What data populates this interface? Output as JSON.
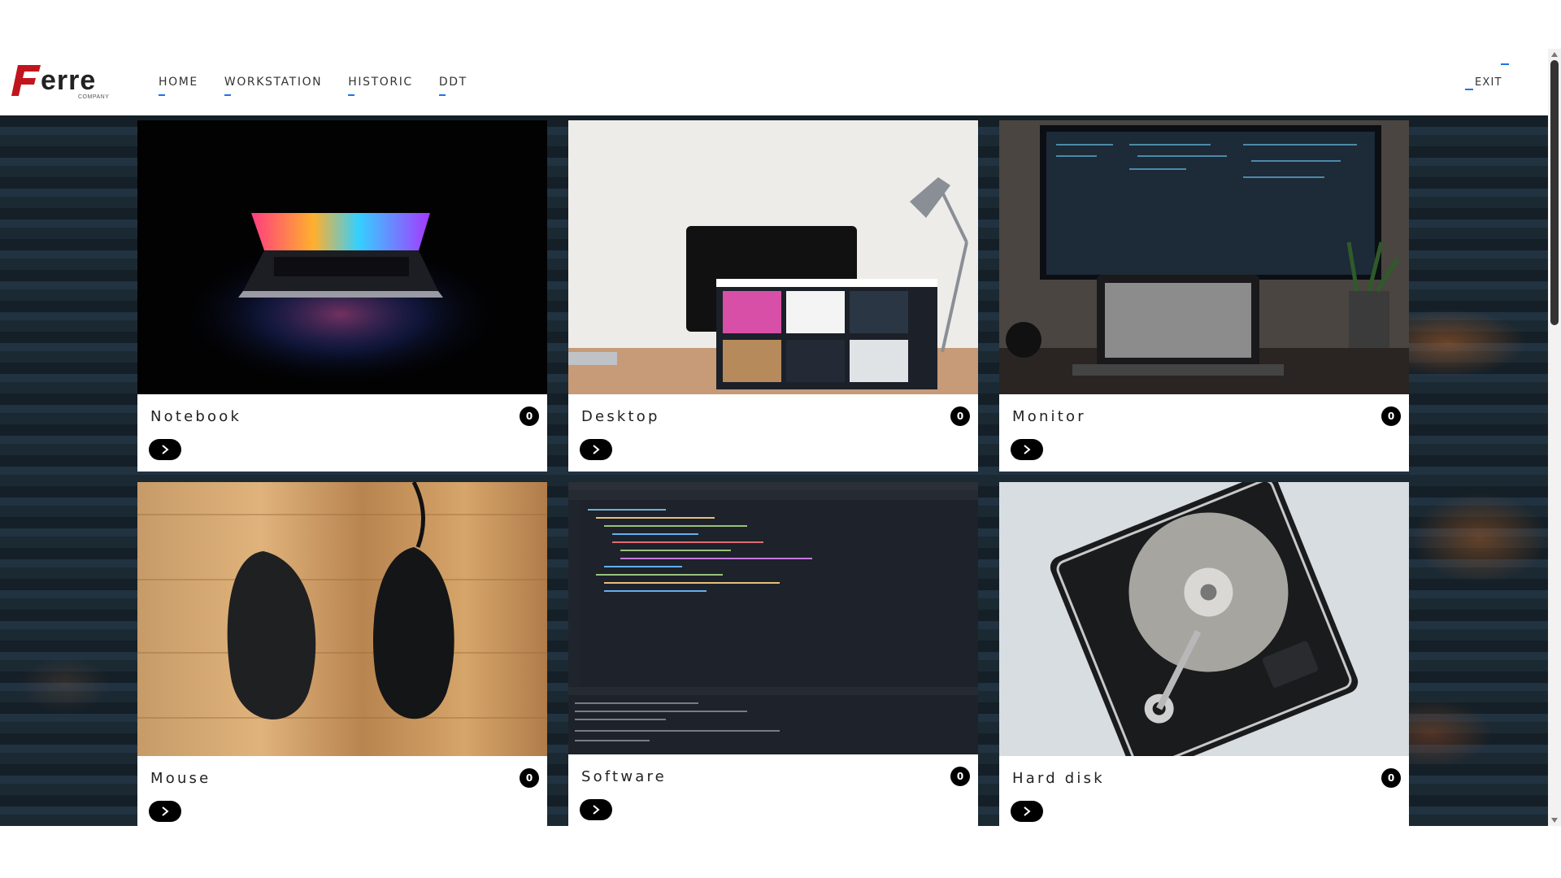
{
  "brand": {
    "name": "erre",
    "sub": "COMPANY",
    "accent": "#c0151d"
  },
  "nav": {
    "items": [
      {
        "label": "HOME"
      },
      {
        "label": "WORKSTATION"
      },
      {
        "label": "HISTORIC"
      },
      {
        "label": "DDT"
      }
    ],
    "exit_label": "EXIT",
    "underline_color": "#1e73e8"
  },
  "cards": [
    {
      "title": "Notebook",
      "count": "0",
      "image": "laptop-photo"
    },
    {
      "title": "Desktop",
      "count": "0",
      "image": "desktop-photo"
    },
    {
      "title": "Monitor",
      "count": "0",
      "image": "monitor-photo"
    },
    {
      "title": "Mouse",
      "count": "0",
      "image": "mouse-photo"
    },
    {
      "title": "Software",
      "count": "0",
      "image": "code-editor-screenshot"
    },
    {
      "title": "Hard disk",
      "count": "0",
      "image": "hard-disk-photo"
    }
  ]
}
